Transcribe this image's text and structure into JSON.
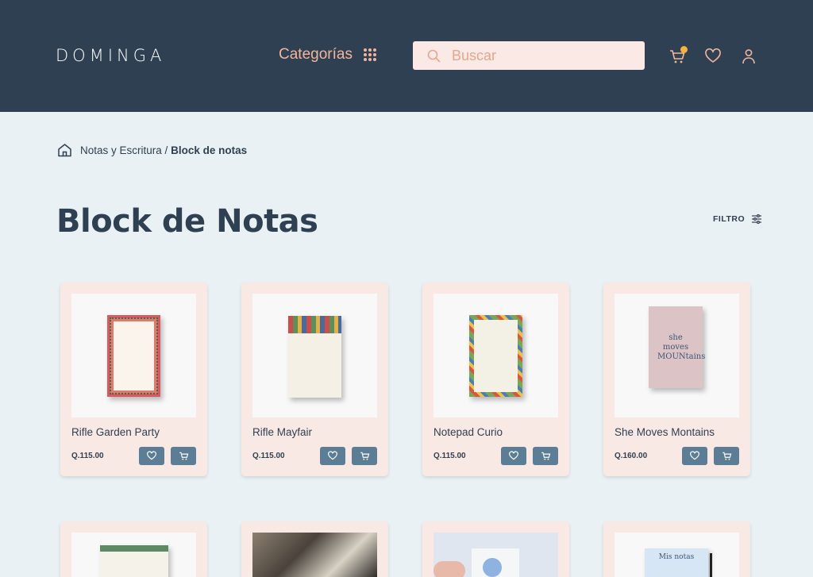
{
  "header": {
    "logo": "DOMINGA",
    "categories_label": "Categorías",
    "search_placeholder": "Buscar"
  },
  "breadcrumb": {
    "parent": "Notas y Escritura",
    "separator": "/",
    "current": "Block de notas"
  },
  "page": {
    "title": "Block de Notas",
    "filter_label": "FILTRO"
  },
  "products": [
    {
      "name": "Rifle Garden Party",
      "price": "Q.115.00"
    },
    {
      "name": "Rifle Mayfair",
      "price": "Q.115.00"
    },
    {
      "name": "Notepad Curio",
      "price": "Q.115.00"
    },
    {
      "name": "She Moves Montains",
      "price": "Q.160.00"
    }
  ],
  "product_image_text": {
    "mountains": "she moves MOUNtains",
    "mis_notas": "Mis notas"
  },
  "colors": {
    "header_bg": "#2e4051",
    "accent": "#f0b69d",
    "page_bg": "#eaf1f4",
    "card_bg": "#f9e9e5",
    "button_bg": "#5b7d95",
    "cart_badge": "#f6b23e"
  }
}
